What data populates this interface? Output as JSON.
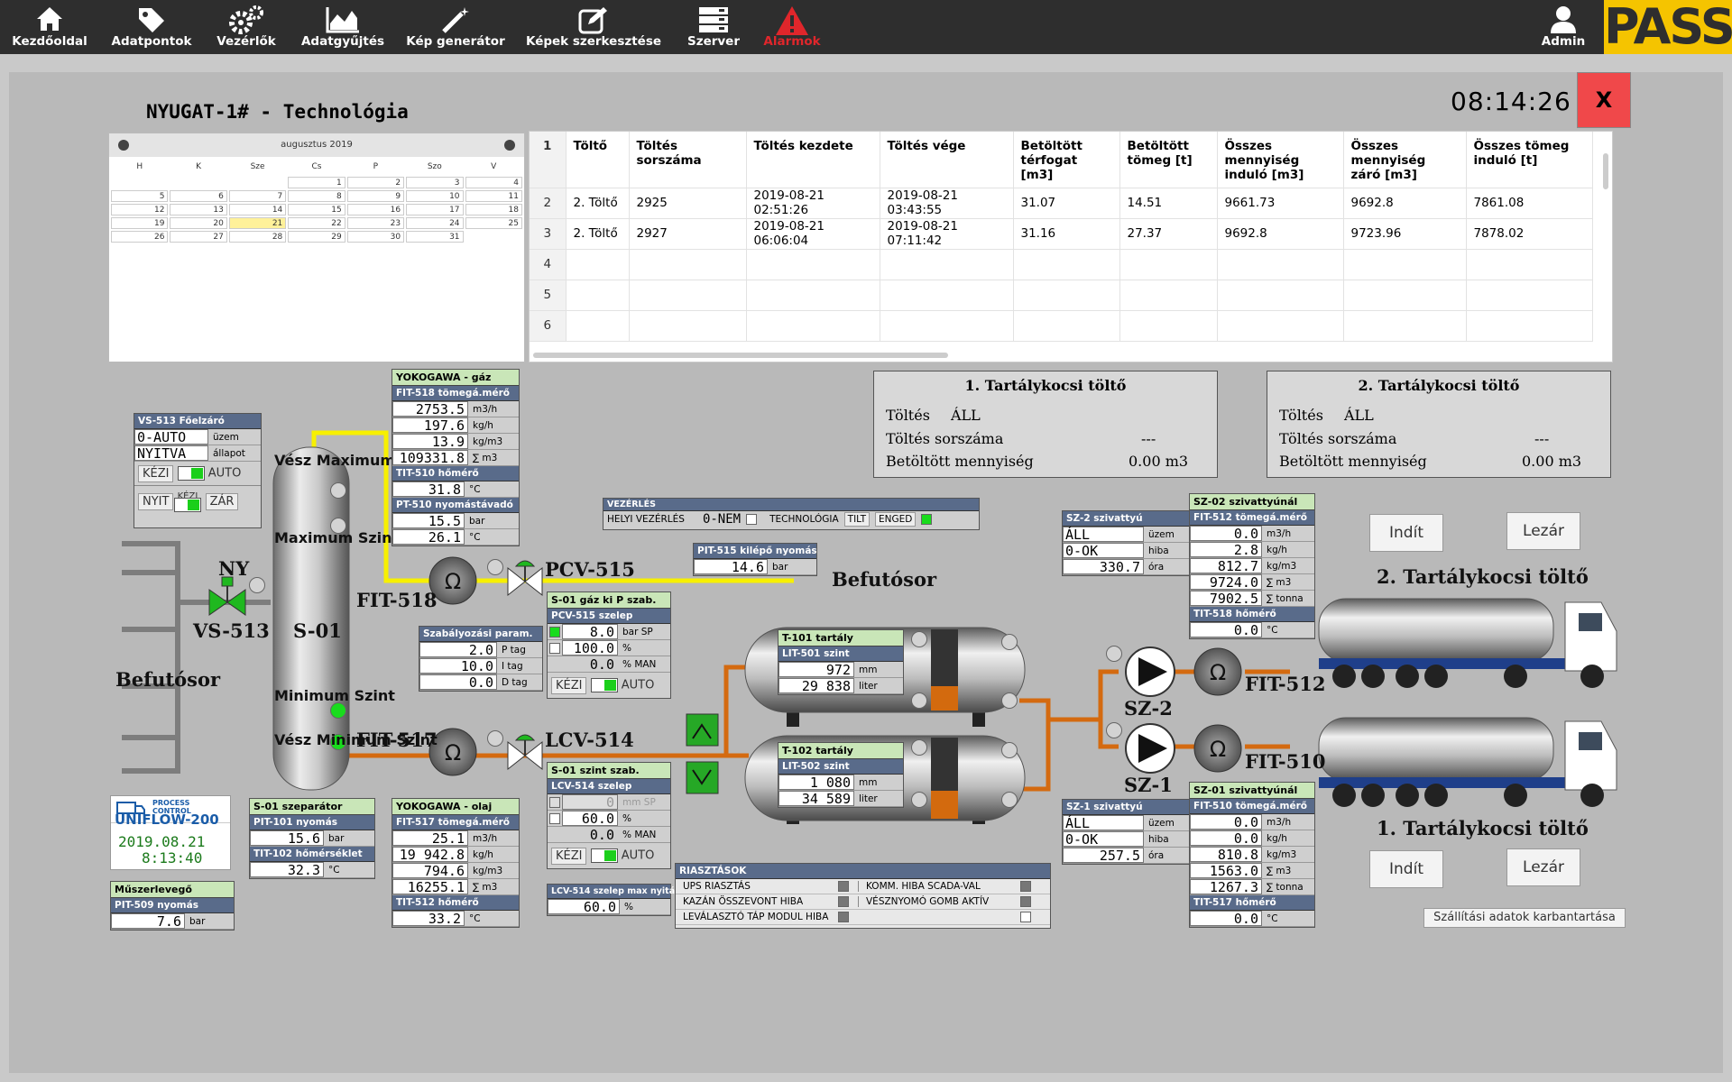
{
  "nav": {
    "items": [
      {
        "label": "Kezdőoldal",
        "icon": "home-icon"
      },
      {
        "label": "Adatpontok",
        "icon": "tag-icon"
      },
      {
        "label": "Vezérlők",
        "icon": "gears-icon"
      },
      {
        "label": "Adatgyűjtés",
        "icon": "area-chart-icon"
      },
      {
        "label": "Kép generátor",
        "icon": "magic-wand-icon"
      },
      {
        "label": "Képek szerkesztése",
        "icon": "edit-icon"
      },
      {
        "label": "Szerver",
        "icon": "server-icon"
      },
      {
        "label": "Alarmok",
        "icon": "warning-icon"
      }
    ],
    "admin": "Admin",
    "logo": "PASS",
    "alarm_color": "#e0262b"
  },
  "page": {
    "title": "NYUGAT-1# - Technológia",
    "clock": "08:14:26",
    "close": "X"
  },
  "calendar": {
    "month": "augusztus 2019",
    "weekdays": [
      "H",
      "K",
      "Sze",
      "Cs",
      "P",
      "Szo",
      "V"
    ],
    "weeks": [
      [
        "",
        "",
        "",
        "1",
        "2",
        "3",
        "4"
      ],
      [
        "5",
        "6",
        "7",
        "8",
        "9",
        "10",
        "11"
      ],
      [
        "12",
        "13",
        "14",
        "15",
        "16",
        "17",
        "18"
      ],
      [
        "19",
        "20",
        "21",
        "22",
        "23",
        "24",
        "25"
      ],
      [
        "26",
        "27",
        "28",
        "29",
        "30",
        "31",
        ""
      ]
    ],
    "selected": "21"
  },
  "grid": {
    "columns": [
      "Töltő",
      "Töltés sorszáma",
      "Töltés kezdete",
      "Töltés vége",
      "Betöltött térfogat [m3]",
      "Betöltött tömeg [t]",
      "Összes mennyiség induló [m3]",
      "Összes mennyiség záró [m3]",
      "Összes tömeg induló [t]"
    ],
    "rows": [
      {
        "n": "2",
        "cells": [
          "2. Töltő",
          "2925",
          "2019-08-21 02:51:26",
          "2019-08-21 03:43:55",
          "31.07",
          "14.51",
          "9661.73",
          "9692.8",
          "7861.08"
        ]
      },
      {
        "n": "3",
        "cells": [
          "2. Töltő",
          "2927",
          "2019-08-21 06:06:04",
          "2019-08-21 07:11:42",
          "31.16",
          "27.37",
          "9692.8",
          "9723.96",
          "7878.02"
        ]
      },
      {
        "n": "4",
        "cells": [
          "",
          "",
          "",
          "",
          "",
          "",
          "",
          "",
          ""
        ]
      },
      {
        "n": "5",
        "cells": [
          "",
          "",
          "",
          "",
          "",
          "",
          "",
          "",
          ""
        ]
      },
      {
        "n": "6",
        "cells": [
          "",
          "",
          "",
          "",
          "",
          "",
          "",
          "",
          ""
        ]
      }
    ],
    "header_row_num": "1"
  },
  "vs513": {
    "title": "VS-513 Főelzáró",
    "r1v": "0-AUTO",
    "r1u": "üzem",
    "r2v": "NYITVA",
    "r2u": "állapot",
    "kezi": "KÉZI",
    "auto": "AUTO",
    "nyit": "NYIT",
    "kezi2": "KÉZI",
    "zar": "ZÁR"
  },
  "yoko_gaz": {
    "title": "YOKOGAWA - gáz",
    "sub1": "FIT-518 tömegá.mérő",
    "rows": [
      {
        "v": "2753.5",
        "u": "m3/h"
      },
      {
        "v": "197.6",
        "u": "kg/h"
      },
      {
        "v": "13.9",
        "u": "kg/m3"
      },
      {
        "v": "109331.8",
        "u": "∑ m3"
      }
    ],
    "sub2": "TIT-510 hőmérő",
    "t_v": "31.8",
    "t_u": "°C",
    "sub3": "PT-510 nyomástávadó",
    "p1_v": "15.5",
    "p1_u": "bar",
    "p2_v": "26.1",
    "p2_u": "°C"
  },
  "vezerles": {
    "title": "VEZÉRLÉS",
    "helyi": "HELYI VEZÉRLÉS",
    "nem": "0-NEM",
    "tech": "TECHNOLÓGIA",
    "tilt": "TILT",
    "enged": "ENGED"
  },
  "pit515": {
    "title": "PIT-515 kilépő nyomás",
    "v": "14.6",
    "u": "bar"
  },
  "s01gaz": {
    "title": "S-01 gáz ki P szab.",
    "sub": "PCV-515 szelep",
    "r1v": "8.0",
    "r1u": "bar SP",
    "r2v": "100.0",
    "r2u": "%",
    "r3v": "0.0",
    "r3u": "% MAN",
    "kezi": "KÉZI",
    "auto": "AUTO"
  },
  "szab": {
    "title": "Szabályozási param.",
    "rows": [
      {
        "v": "2.0",
        "u": "P tag"
      },
      {
        "v": "10.0",
        "u": "I tag"
      },
      {
        "v": "0.0",
        "u": "D tag"
      }
    ]
  },
  "s01szint": {
    "title": "S-01 szint szab.",
    "sub": "LCV-514 szelep",
    "r1v": "0",
    "r1u": "mm SP",
    "r2v": "60.0",
    "r2u": "%",
    "r3v": "0.0",
    "r3u": "% MAN",
    "kezi": "KÉZI",
    "auto": "AUTO",
    "max_title": "LCV-514 szelep max nyitás",
    "max_v": "60.0",
    "max_u": "%"
  },
  "t101": {
    "title": "T-101 tartály",
    "sub": "LIT-501 szint",
    "r1v": "972",
    "r1u": "mm",
    "r2v": "29 838",
    "r2u": "liter",
    "level": 0.3
  },
  "t102": {
    "title": "T-102 tartály",
    "sub": "LIT-502 szint",
    "r1v": "1 080",
    "r1u": "mm",
    "r2v": "34 589",
    "r2u": "liter",
    "level": 0.35
  },
  "riaszt": {
    "title": "RIASZTÁSOK",
    "left": [
      "UPS RIASZTÁS",
      "KAZÁN ÖSSZEVONT HIBA",
      "LEVÁLASZTÓ TÁP MODUL HIBA"
    ],
    "right": [
      "KOMM. HIBA SCADA-VAL",
      "VÉSZNYOMÓ GOMB AKTÍV",
      ""
    ]
  },
  "sz2": {
    "title": "SZ-2 szivattyú",
    "r1v": "ÁLL",
    "r1u": "üzem",
    "r2v": "0-OK",
    "r2u": "hiba",
    "r3v": "330.7",
    "r3u": "óra"
  },
  "sz1": {
    "title": "SZ-1 szivattyú",
    "r1v": "ÁLL",
    "r1u": "üzem",
    "r2v": "0-OK",
    "r2u": "hiba",
    "r3v": "257.5",
    "r3u": "óra"
  },
  "sz02": {
    "title": "SZ-02 szivattyúnál",
    "sub": "FIT-512 tömegá.mérő",
    "rows": [
      {
        "v": "0.0",
        "u": "m3/h"
      },
      {
        "v": "2.8",
        "u": "kg/h"
      },
      {
        "v": "812.7",
        "u": "kg/m3"
      },
      {
        "v": "9724.0",
        "u": "∑ m3"
      },
      {
        "v": "7902.5",
        "u": "∑ tonna"
      }
    ],
    "sub2": "TIT-518 hőmérő",
    "t_v": "0.0",
    "t_u": "°C"
  },
  "sz01": {
    "title": "SZ-01 szivattyúnál",
    "sub": "FIT-510 tömegá.mérő",
    "rows": [
      {
        "v": "0.0",
        "u": "m3/h"
      },
      {
        "v": "0.0",
        "u": "kg/h"
      },
      {
        "v": "810.8",
        "u": "kg/m3"
      },
      {
        "v": "1563.0",
        "u": "∑ m3"
      },
      {
        "v": "1267.3",
        "u": "∑ tonna"
      }
    ],
    "sub2": "TIT-517 hőmérő",
    "t_v": "0.0",
    "t_u": "°C"
  },
  "toltes1": {
    "title": "1. Tartálykocsi töltő",
    "l1": "Töltés",
    "v1": "ÁLL",
    "l2": "Töltés sorszáma",
    "v2": "---",
    "l3": "Betöltött mennyiség",
    "v3": "0.00 m3"
  },
  "toltes2": {
    "title": "2. Tartálykocsi töltő",
    "l1": "Töltés",
    "v1": "ÁLL",
    "l2": "Töltés sorszáma",
    "v2": "---",
    "l3": "Betöltött mennyiség",
    "v3": "0.00 m3"
  },
  "buttons": {
    "indit": "Indít",
    "lezar": "Lezár",
    "maint": "Szállítási adatok karbantartása"
  },
  "labels": {
    "truck2": "2. Tartálykocsi töltő",
    "truck1": "1. Tartálykocsi töltő",
    "befutosor_left": "Befutósor",
    "befutosor_right": "Befutósor",
    "ny": "NY",
    "vs513": "VS-513",
    "s01": "S-01",
    "fit518": "FIT-518",
    "fit517": "FIT-517",
    "pcv515": "PCV-515",
    "lcv514": "LCV-514",
    "sz2": "SZ-2",
    "sz1": "SZ-1",
    "fit512": "FIT-512",
    "fit510": "FIT-510",
    "vesz_max": "Vész Maximum Szint",
    "max": "Maximum Szint",
    "min": "Minimum Szint",
    "vesz_min": "Vész Minimum Szint"
  },
  "s01sep": {
    "title": "S-01 szeparátor",
    "sub1": "PIT-101 nyomás",
    "p_v": "15.6",
    "p_u": "bar",
    "sub2": "TIT-102 hőmérséklet",
    "t_v": "32.3",
    "t_u": "°C"
  },
  "yoko_olaj": {
    "title": "YOKOGAWA - olaj",
    "sub1": "FIT-517 tömegá.mérő",
    "rows": [
      {
        "v": "25.1",
        "u": "m3/h"
      },
      {
        "v": "19 942.8",
        "u": "kg/h"
      },
      {
        "v": "794.6",
        "u": "kg/m3"
      },
      {
        "v": "16255.1",
        "u": "∑ m3"
      }
    ],
    "sub2": "TIT-512 hőmérő",
    "t_v": "33.2",
    "t_u": "°C"
  },
  "uniflow": {
    "line1": "PROCESS",
    "line2": "CONTROL",
    "name": "UNIFLOW-200",
    "date": "2019.08.21",
    "time": "8:13:40"
  },
  "muszer": {
    "title": "Műszerlevegő",
    "sub": "PIT-509 nyomás",
    "v": "7.6",
    "u": "bar"
  }
}
